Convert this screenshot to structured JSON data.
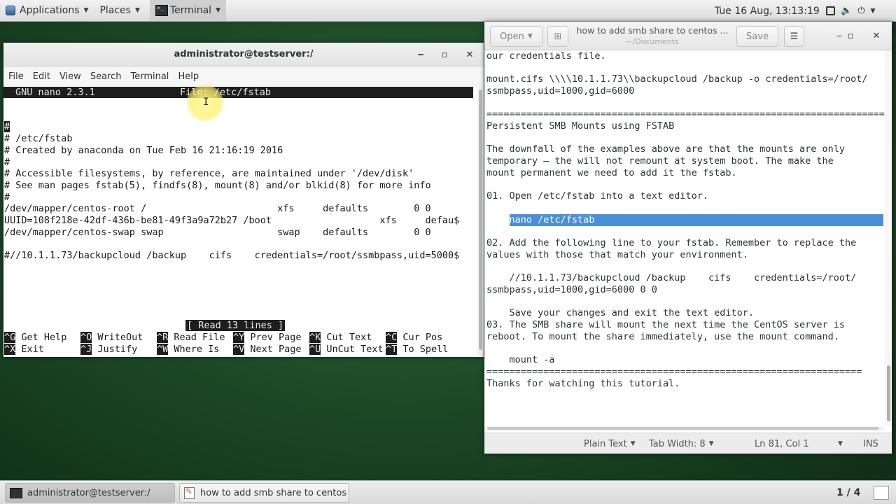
{
  "top_panel": {
    "applications": "Applications",
    "places": "Places",
    "terminal": "Terminal",
    "clock": "Tue 16 Aug, 13:13:19",
    "icons": [
      "screen-icon",
      "volume-icon",
      "power-icon"
    ]
  },
  "terminal_window": {
    "title": "administrator@testserver:/",
    "menu": [
      "File",
      "Edit",
      "View",
      "Search",
      "Terminal",
      "Help"
    ],
    "nano_version": "GNU nano 2.3.1",
    "nano_file": "File: /etc/fstab",
    "lines": [
      "#",
      "# /etc/fstab",
      "# Created by anaconda on Tue Feb 16 21:16:19 2016",
      "#",
      "# Accessible filesystems, by reference, are maintained under '/dev/disk'",
      "# See man pages fstab(5), findfs(8), mount(8) and/or blkid(8) for more info",
      "#",
      "/dev/mapper/centos-root /                       xfs     defaults        0 0",
      "UUID=108f218e-42df-436b-be81-49f3a9a72b27 /boot                   xfs     defau$",
      "/dev/mapper/centos-swap swap                    swap    defaults        0 0",
      "",
      "#//10.1.1.73/backupcloud /backup    cifs    credentials=/root/ssmbpass,uid=5000$"
    ],
    "status_message": "[ Read 13 lines ]",
    "shortcuts_row1": [
      {
        "key": "^G",
        "label": "Get Help"
      },
      {
        "key": "^O",
        "label": "WriteOut"
      },
      {
        "key": "^R",
        "label": "Read File"
      },
      {
        "key": "^Y",
        "label": "Prev Page"
      },
      {
        "key": "^K",
        "label": "Cut Text"
      },
      {
        "key": "^C",
        "label": "Cur Pos"
      }
    ],
    "shortcuts_row2": [
      {
        "key": "^X",
        "label": "Exit"
      },
      {
        "key": "^J",
        "label": "Justify"
      },
      {
        "key": "^W",
        "label": "Where Is"
      },
      {
        "key": "^V",
        "label": "Next Page"
      },
      {
        "key": "^U",
        "label": "UnCut Text"
      },
      {
        "key": "^T",
        "label": "To Spell"
      }
    ]
  },
  "gedit_window": {
    "open_label": "Open",
    "title": "how to add smb share to centos ...",
    "subtitle": "~/Documents",
    "save_label": "Save",
    "lines": [
      "our credentials file.",
      "",
      "mount.cifs \\\\\\\\10.1.1.73\\\\backupcloud /backup -o credentials=/root/",
      "ssmbpass,uid=1000,gid=6000",
      "",
      "============================================================================",
      "Persistent SMB Mounts using FSTAB",
      "",
      "The downfall of the examples above are that the mounts are only",
      "temporary – the will not remount at system boot. The make the",
      "mount permanent we need to add it the fstab.",
      "",
      "01. Open /etc/fstab into a text editor.",
      "",
      "    nano /etc/fstab",
      "",
      "02. Add the following line to your fstab. Remember to replace the",
      "values with those that match your environment.",
      "",
      "    //10.1.1.73/backupcloud /backup    cifs    credentials=/root/",
      "ssmbpass,uid=1000,gid=6000 0 0",
      "",
      "    Save your changes and exit the text editor.",
      "03. The SMB share will mount the next time the CentOS server is",
      "reboot. To mount the share immediately, use the mount command.",
      "",
      "    mount -a",
      "==================================================================",
      "Thanks for watching this tutorial."
    ],
    "status": {
      "language": "Plain Text",
      "tab_width": "Tab Width: 8",
      "position": "Ln 81, Col 1",
      "mode": "INS"
    }
  },
  "taskbar": {
    "task_terminal": "administrator@testserver:/",
    "task_gedit": "how to add smb share to centos ...",
    "workspace": "1 / 4"
  }
}
